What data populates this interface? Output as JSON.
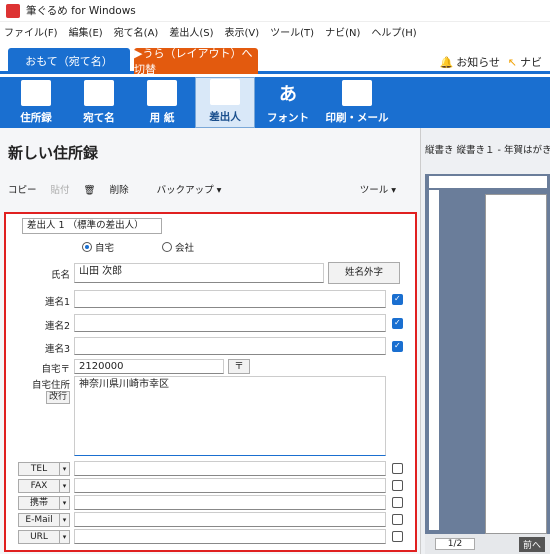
{
  "app": {
    "title": "筆ぐるめ for Windows"
  },
  "menu": [
    "ファイル(F)",
    "編集(E)",
    "宛て名(A)",
    "差出人(S)",
    "表示(V)",
    "ツール(T)",
    "ナビ(N)",
    "ヘルプ(H)"
  ],
  "mode": {
    "omote": "おもて（宛て名）",
    "ura": "▶うら（レイアウト）へ切替",
    "notice": "お知らせ",
    "navi": "ナビ"
  },
  "ribbon": [
    "住所録",
    "宛て名",
    "用 紙",
    "差出人",
    "フォント",
    "印刷・メール"
  ],
  "page": {
    "title": "新しい住所録"
  },
  "toolbar": {
    "copy": "コピー",
    "paste": "貼付",
    "delete": "削除",
    "backup": "バックアップ ▾",
    "tools": "ツール ▾"
  },
  "form": {
    "sender_select": "差出人 1 （標準の差出人）",
    "radio_home": "自宅",
    "radio_company": "会社",
    "name_label": "氏名",
    "name_value": "山田 次郎",
    "name_button": "姓名外字",
    "renmei1": "連名1",
    "renmei2": "連名2",
    "renmei3": "連名3",
    "zip_label": "自宅〒",
    "zip_value": "2120000",
    "zip_button": "〒",
    "addr_label": "自宅住所",
    "addr_button": "改行",
    "addr_value": "神奈川県川崎市幸区",
    "phones": [
      "TEL",
      "FAX",
      "携帯",
      "E-Mail",
      "URL"
    ]
  },
  "preview": {
    "title": "縦書き 縦書き１ - 年賀はがき",
    "page": "1/2",
    "next": "前へ"
  },
  "colors": {
    "accent": "#1a6fd0",
    "ura": "#e35a0e",
    "highlight": "#e02020"
  }
}
